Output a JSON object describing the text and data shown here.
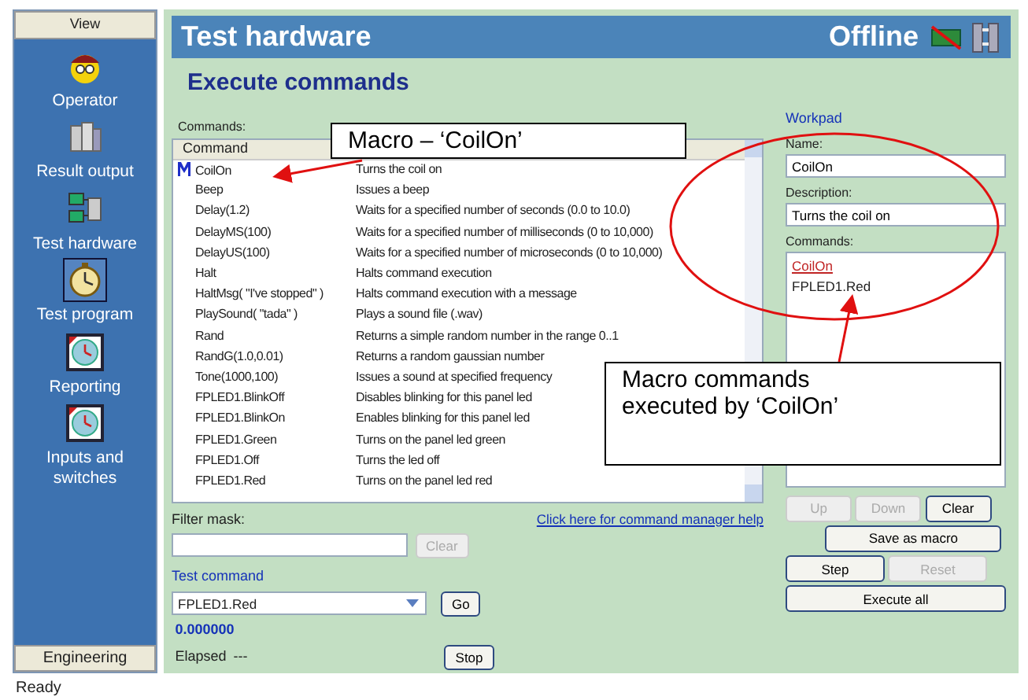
{
  "sidebar": {
    "header": "View",
    "items": [
      {
        "label": "Operator",
        "selected": false
      },
      {
        "label": "Result output",
        "selected": false
      },
      {
        "label": "Test hardware",
        "selected": false
      },
      {
        "label": "Test program",
        "selected": true
      },
      {
        "label": "Reporting",
        "selected": false
      },
      {
        "label": "Inputs and switches",
        "selected": false
      }
    ],
    "footer": "Engineering"
  },
  "header": {
    "title": "Test hardware",
    "connection": "Offline"
  },
  "section_title": "Execute commands",
  "commands": {
    "label": "Commands:",
    "columns": [
      "Command"
    ],
    "rows": [
      {
        "name": "CoilOn",
        "description": "Turns the coil on",
        "kind": "macro"
      },
      {
        "name": "Beep",
        "description": "Issues a beep",
        "kind": "command"
      },
      {
        "name": "Delay(1.2)",
        "description": "Waits for a specified number of seconds (0.0 to 10.0)",
        "kind": "command"
      },
      {
        "name": "DelayMS(100)",
        "description": "Waits for a specified number of milliseconds (0 to 10,000)",
        "kind": "command"
      },
      {
        "name": "DelayUS(100)",
        "description": "Waits for a specified number of microseconds (0 to 10,000)",
        "kind": "command"
      },
      {
        "name": "Halt",
        "description": "Halts command execution",
        "kind": "command"
      },
      {
        "name": "HaltMsg( \"I've stopped\" )",
        "description": "Halts command execution with a message",
        "kind": "command"
      },
      {
        "name": "PlaySound( \"tada\" )",
        "description": "Plays a sound file (.wav)",
        "kind": "command"
      },
      {
        "name": "Rand",
        "description": "Returns a simple random number in the range 0..1",
        "kind": "command"
      },
      {
        "name": "RandG(1.0,0.01)",
        "description": "Returns a random gaussian number",
        "kind": "command"
      },
      {
        "name": "Tone(1000,100)",
        "description": "Issues a sound at specified frequency",
        "kind": "command"
      },
      {
        "name": "FPLED1.BlinkOff",
        "description": "Disables blinking for this panel led",
        "kind": "command"
      },
      {
        "name": "FPLED1.BlinkOn",
        "description": "Enables blinking for this panel led",
        "kind": "command"
      },
      {
        "name": "FPLED1.Green",
        "description": "Turns on the panel led green",
        "kind": "command"
      },
      {
        "name": "FPLED1.Off",
        "description": "Turns the led off",
        "kind": "command"
      },
      {
        "name": "FPLED1.Red",
        "description": "Turns on the panel led red",
        "kind": "command"
      }
    ]
  },
  "filter": {
    "label": "Filter mask:",
    "button": {
      "label": "Clear",
      "disabled": true
    }
  },
  "help_link": "Click here for command manager help",
  "test_command": {
    "label": "Test command",
    "value": "FPLED1.Red",
    "go": "Go",
    "reading": "0.000000",
    "elapsed_label": "Elapsed",
    "elapsed_value": "---",
    "stop": "Stop"
  },
  "workpad": {
    "title": "Workpad",
    "name_label": "Name:",
    "name": "CoilOn",
    "description_label": "Description:",
    "description": "Turns the coil on",
    "commands_label": "Commands:",
    "commands": [
      {
        "text": "CoilOn",
        "kind": "macro"
      },
      {
        "text": "FPLED1.Red",
        "kind": "command"
      }
    ],
    "buttons": [
      {
        "label": "Up",
        "disabled": true,
        "kind": "small"
      },
      {
        "label": "Down",
        "disabled": true,
        "kind": "small"
      },
      {
        "label": "Clear",
        "disabled": false,
        "kind": "small"
      },
      {
        "label": "Save as macro",
        "disabled": false,
        "kind": "wide"
      },
      {
        "label": "Step",
        "disabled": false,
        "kind": "half"
      },
      {
        "label": "Reset",
        "disabled": true,
        "kind": "half"
      },
      {
        "label": "Execute all",
        "disabled": false,
        "kind": "full"
      }
    ]
  },
  "annotations": [
    {
      "text": "Macro – ‘CoilOn’",
      "kind": "macro"
    },
    {
      "text": "Macro commands executed by ‘CoilOn’",
      "kind": "workpad"
    }
  ],
  "status_bar": "Ready"
}
